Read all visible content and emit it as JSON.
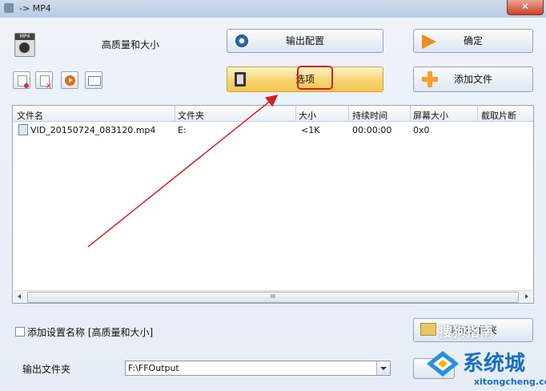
{
  "window": {
    "title": "-> MP4",
    "close_glyph": "✕"
  },
  "profile": {
    "label": "高质量和大小",
    "icon": "camera-icon",
    "badge": "MP4"
  },
  "buttons": {
    "output_config": "输出配置",
    "ok": "确定",
    "options": "选项",
    "add_file": "添加文件",
    "add_folder": "添加文件夹"
  },
  "toolbar": [
    "remove-file-icon",
    "delete-icon",
    "play-icon",
    "info-icon"
  ],
  "table": {
    "headers": [
      "文件名",
      "文件夹",
      "大小",
      "持续时间",
      "屏幕大小",
      "截取片断"
    ],
    "rows": [
      {
        "name": "VID_20150724_083120.mp4",
        "folder": "E:",
        "size": "<1K",
        "duration": "00:00:00",
        "screen": "0x0",
        "clip": ""
      }
    ],
    "scroll_grip": "III"
  },
  "settings": {
    "add_name_label": "添加设置名称 [高质量和大小]",
    "checked": false
  },
  "output": {
    "label": "输出文件夹",
    "value": "F:\\FFOutput"
  },
  "watermark": {
    "text1": "系统城",
    "text2": "xitongcheng.com",
    "text3": "搜狗指南"
  },
  "colors": {
    "highlight": "#d42020",
    "arrow": "#d42020",
    "options_button": "#f9d472"
  }
}
